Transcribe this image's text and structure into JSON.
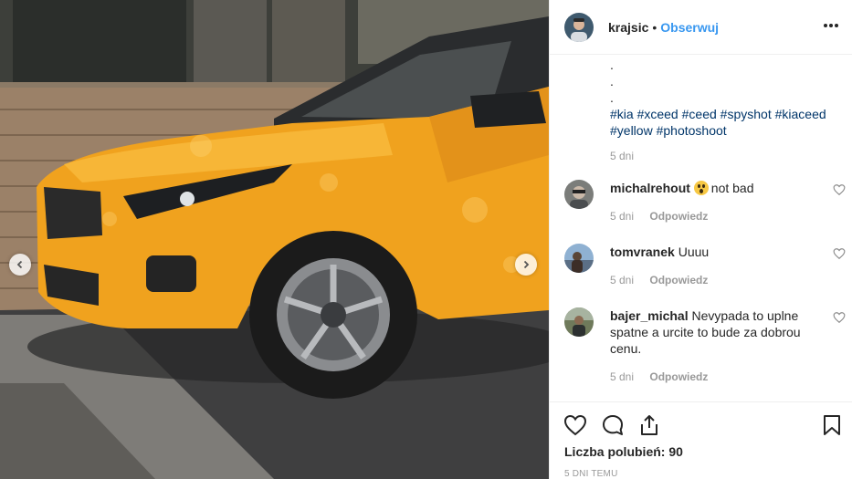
{
  "post": {
    "username": "krajsic",
    "separator": "•",
    "follow_label": "Obserwuj"
  },
  "caption": {
    "dots": [
      ".",
      ".",
      "."
    ],
    "hashtags": [
      "#kia",
      "#xceed",
      "#ceed",
      "#spyshot",
      "#kiaceed",
      "#yellow",
      "#photoshoot"
    ],
    "time": "5 dni"
  },
  "comments": [
    {
      "user": "michalrehout",
      "emoji": "astonished-face",
      "text": "not bad",
      "time": "5 dni",
      "reply_label": "Odpowiedz"
    },
    {
      "user": "tomvranek",
      "text": "Uuuu",
      "time": "5 dni",
      "reply_label": "Odpowiedz"
    },
    {
      "user": "bajer_michal",
      "text": "Nevypada to uplne spatne a urcite to bude za dobrou cenu.",
      "time": "5 dni",
      "reply_label": "Odpowiedz"
    }
  ],
  "footer": {
    "likes_label": "Liczba polubień: 90",
    "date": "5 DNI TEMU"
  },
  "icons": {
    "prev": "chevron-left-icon",
    "next": "chevron-right-icon",
    "more": "more-options-icon",
    "like": "heart-icon",
    "comment": "comment-bubble-icon",
    "share": "share-icon",
    "save": "bookmark-icon"
  },
  "colors": {
    "link": "#3897f0",
    "hashtag": "#003569",
    "muted": "#999999",
    "car": "#f0a21e"
  }
}
